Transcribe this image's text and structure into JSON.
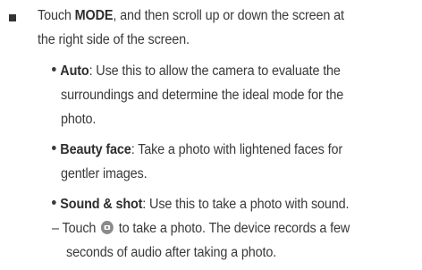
{
  "main_item": {
    "line1_pre": "Touch ",
    "line1_bold": "MODE",
    "line1_post": ", and then scroll up or down the screen at",
    "line2": "the right side of the screen."
  },
  "modes": [
    {
      "name": "Auto",
      "line1": ": Use this to allow the camera to evaluate the",
      "line2": "surroundings and determine the ideal mode for the",
      "line3": "photo."
    },
    {
      "name": "Beauty face",
      "line1": ": Take a photo with lightened faces for",
      "line2": "gentler images."
    },
    {
      "name": "Sound & shot",
      "line1": ": Use this to take a photo with sound."
    }
  ],
  "sub_step": {
    "dash": "–",
    "pre": "Touch",
    "post": "to take a photo. The device records a few",
    "line2": "seconds of audio after taking a photo."
  },
  "icons": {
    "main_bullet": "square-bullet-icon",
    "sub_bullet": "dot-bullet-icon",
    "camera": "camera-icon"
  }
}
